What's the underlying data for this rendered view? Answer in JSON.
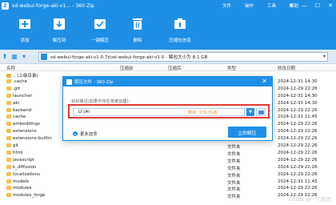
{
  "window": {
    "title": "sd-webui-forge-aki-v1... - 360 Zip",
    "menus": [
      "文件",
      "操作",
      "工具",
      "帮助"
    ],
    "controls": [
      "≡",
      "—",
      "☐",
      "✕"
    ]
  },
  "toolbar": [
    {
      "label": "添加",
      "icon": "add-icon"
    },
    {
      "label": "解压到",
      "icon": "extract-to-icon"
    },
    {
      "label": "一键解压",
      "icon": "one-click-extract-icon"
    },
    {
      "label": "删除",
      "icon": "delete-icon"
    },
    {
      "label": "压缩包信息",
      "icon": "archive-info-icon"
    }
  ],
  "addressbar": {
    "path": "sd-webui-forge-aki-v1.0.7z\\sd-webui-forge-aki-v1.0 - 解包大小为 8.1 GB"
  },
  "filelist": {
    "headers": {
      "name": "名称",
      "size": "压缩前",
      "packed": "压缩后",
      "type": "类型",
      "modified": "修改日期"
    },
    "rows": [
      {
        "name": ".. (上级目录)",
        "type": "",
        "modified": "",
        "parent": true
      },
      {
        "name": ".cache",
        "type": "",
        "modified": "2024-12-31 14:30"
      },
      {
        "name": ".git",
        "type": "",
        "modified": "2024-12-29 22:26"
      },
      {
        "name": "launcher",
        "type": "",
        "modified": "2024-12-31 14:30"
      },
      {
        "name": "aki",
        "type": "",
        "modified": "2024-12-31 14:30"
      },
      {
        "name": "backend",
        "type": "",
        "modified": "2024-12-29 22:26"
      },
      {
        "name": "cache",
        "type": "",
        "modified": "2024-12-31 11:45"
      },
      {
        "name": "embeddings",
        "type": "",
        "modified": "2024-12-29 22:26"
      },
      {
        "name": "extensions",
        "type": "",
        "modified": "2024-12-29 22:26"
      },
      {
        "name": "extensions-builtin",
        "type": "",
        "modified": "2024-12-29 22:26"
      },
      {
        "name": "git",
        "type": "文件夹",
        "modified": "2024-12-29 22:26"
      },
      {
        "name": "html",
        "type": "文件夹",
        "modified": "2024-12-29 22:26"
      },
      {
        "name": "javascript",
        "type": "文件夹",
        "modified": "2024-12-29 22:26"
      },
      {
        "name": "k_diffusion",
        "type": "文件夹",
        "modified": "2024-12-29 22:26"
      },
      {
        "name": "localizations",
        "type": "文件夹",
        "modified": "2024-12-29 22:26"
      },
      {
        "name": "models",
        "type": "文件夹",
        "modified": "2024-12-31 11:45"
      },
      {
        "name": "modules",
        "type": "文件夹",
        "modified": "2024-12-29 22:26"
      },
      {
        "name": "modules_forge",
        "type": "文件夹",
        "modified": "2024-12-29 22:26"
      }
    ]
  },
  "dialog": {
    "title": "解压文件 - 360 Zip",
    "close": "✕",
    "hint": "目标路径(如果不存在将被创建)：",
    "path_value": "D:\\AI",
    "free_space": "剩余: 156.5GB",
    "dropdown_glyph": "▼",
    "more_options": "更多选项",
    "extract_button": "立即解压"
  },
  "watermark": "CSDN @一个月月"
}
